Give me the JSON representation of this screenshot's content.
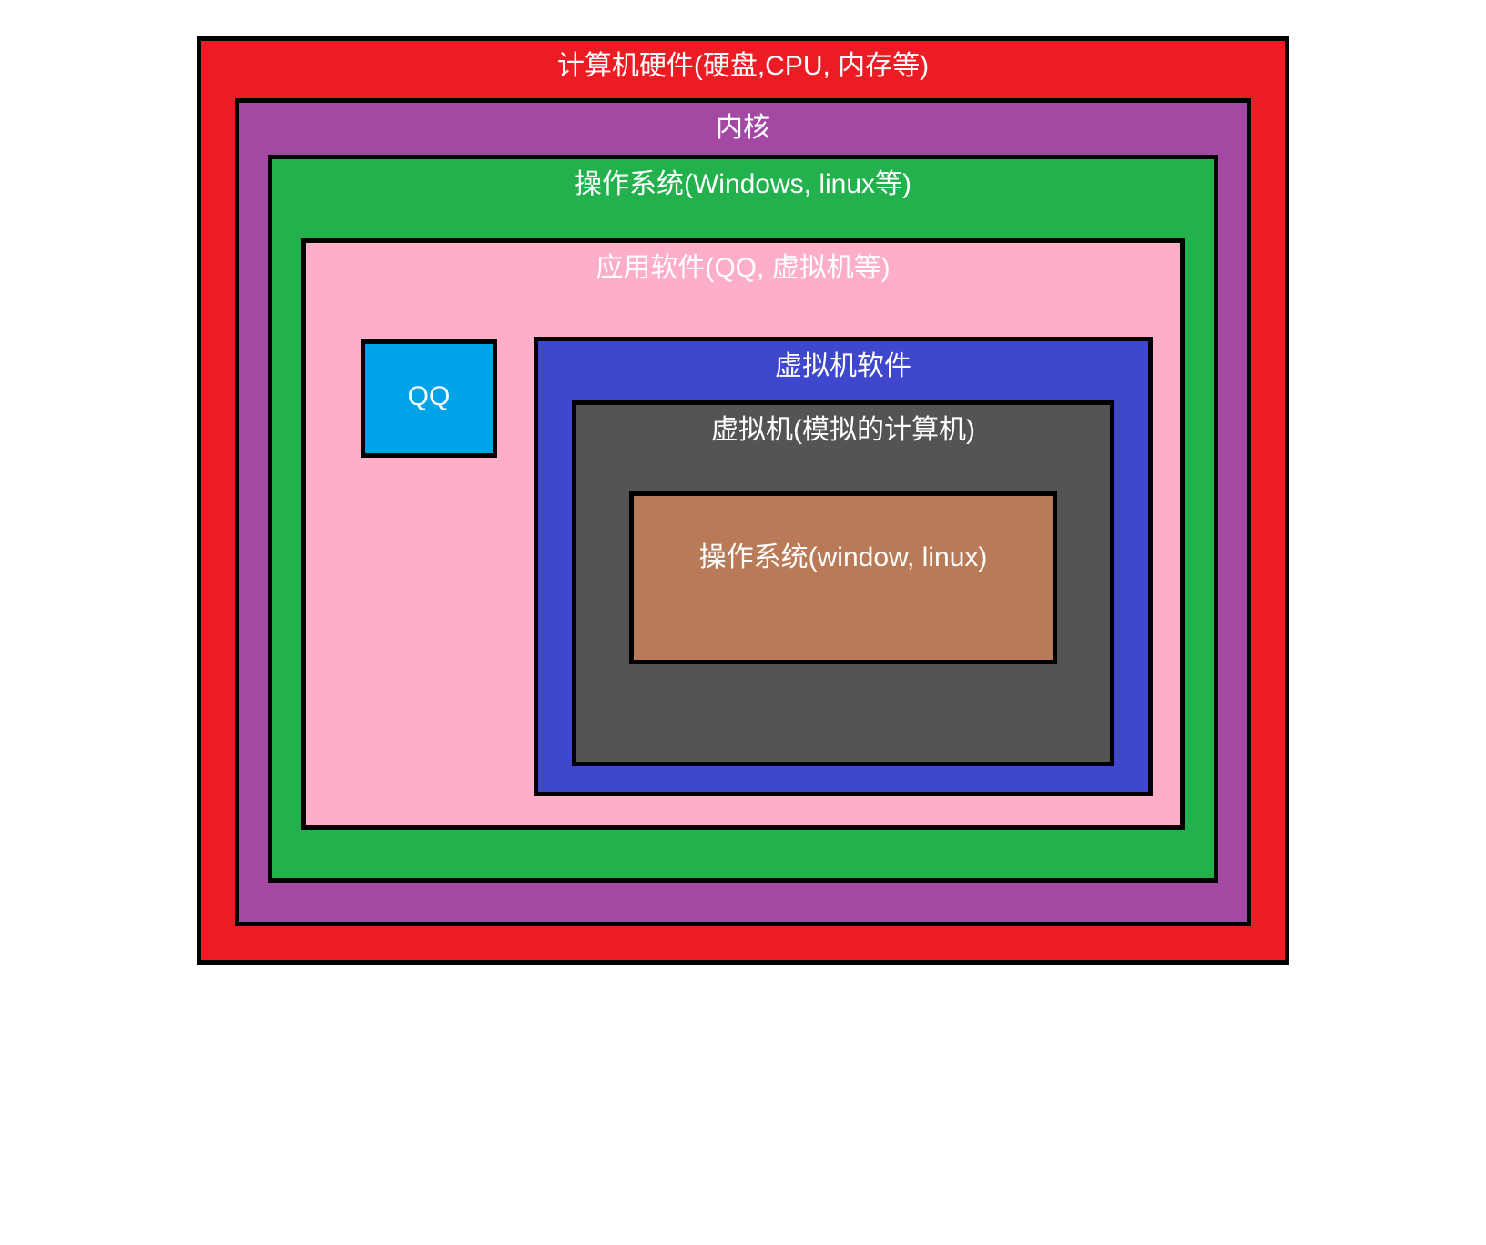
{
  "layers": {
    "hardware": "计算机硬件(硬盘,CPU, 内存等)",
    "kernel": "内核",
    "os": "操作系统(Windows, linux等)",
    "apps": "应用软件(QQ, 虚拟机等)",
    "qq": "QQ",
    "vmsoft": "虚拟机软件",
    "vm": "虚拟机(模拟的计算机)",
    "inneros": "操作系统(window, linux)"
  },
  "colors": {
    "hardware": "#ed1c24",
    "kernel": "#a349a4",
    "os": "#22b14c",
    "apps": "#ffaec9",
    "qq": "#00a2e8",
    "vmsoft": "#3f48cc",
    "vm": "#545454",
    "inneros": "#b97a57",
    "border": "#000000",
    "text": "#ffffff"
  }
}
